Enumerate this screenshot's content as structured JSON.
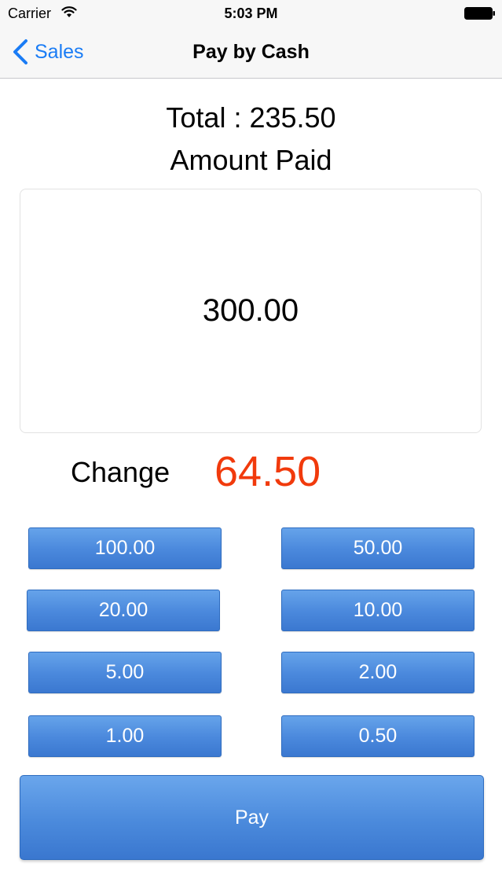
{
  "status_bar": {
    "carrier": "Carrier",
    "time": "5:03 PM",
    "icons": [
      "wifi-icon",
      "battery-icon"
    ]
  },
  "nav": {
    "back_label": "Sales",
    "title": "Pay by Cash",
    "accent_color": "#1a7cf5"
  },
  "payment": {
    "total_text": "Total : 235.50",
    "amount_paid_label": "Amount Paid",
    "amount_paid_value": "300.00",
    "change_label": "Change",
    "change_value": "64.50",
    "change_color": "#f13a0c"
  },
  "cash_buttons": [
    "100.00",
    "50.00",
    "20.00",
    "10.00",
    "5.00",
    "2.00",
    "1.00",
    "0.50"
  ],
  "pay_button_label": "Pay",
  "button_color": "#4a88dc"
}
